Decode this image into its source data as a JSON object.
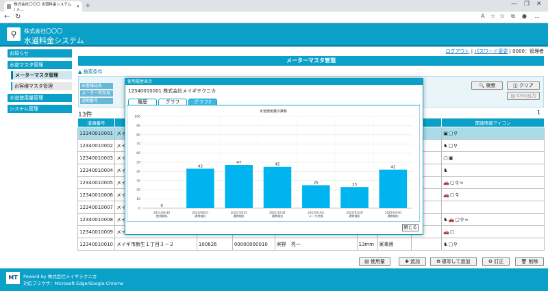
{
  "browser": {
    "tab_title": "株式会社〇〇〇 水道料金システム / メ...",
    "new_tab": "+",
    "url": ""
  },
  "header": {
    "company": "株式会社〇〇〇",
    "system": "水道料金システム"
  },
  "toplinks": {
    "logout": "ログアウト",
    "sep": " | ",
    "change_password": "パスワード変更",
    "user": " | 0000：管理者"
  },
  "sidebar": {
    "items": [
      {
        "label": "お知らせ"
      },
      {
        "label": "水道マスタ管理"
      },
      {
        "label": "メーターマスタ管理"
      },
      {
        "label": "お客様マスタ管理"
      },
      {
        "label": "水道使用量管理"
      },
      {
        "label": "システム管理"
      }
    ]
  },
  "main": {
    "title": "メーターマスタ管理",
    "cond_header": "▲ 検索条件",
    "cond_labels": [
      "お客様氏名",
      "メーター所在地",
      "週期番号"
    ],
    "search_button": "検索",
    "clear_button": "クリア",
    "csv_button": "CSV出力",
    "count": "13件",
    "page": "1"
  },
  "table": {
    "headers": [
      "道順番号",
      "",
      "",
      "",
      "",
      "",
      "",
      "",
      "関連情報アイコン"
    ],
    "rows": [
      {
        "no": "12340010001",
        "c2": "メイ"
      },
      {
        "no": "12340010002",
        "c2": "メイ"
      },
      {
        "no": "12340010003",
        "c2": "メイ"
      },
      {
        "no": "12340010004",
        "c2": "メイ"
      },
      {
        "no": "12340010005",
        "c2": "メイ"
      },
      {
        "no": "12340010006",
        "c2": "メイ"
      },
      {
        "no": "12340010007",
        "c2": "メイ"
      },
      {
        "no": "12340010008",
        "c2": "メイ"
      },
      {
        "no": "12340010009",
        "c2": "メイ"
      },
      {
        "no": "12340010010",
        "c2": "メイギ市新生１丁目３－２",
        "c3": "100626",
        "c4": "00000000010",
        "c5": "呉野　亮一",
        "c6": "13mm",
        "c7": "家事用"
      }
    ]
  },
  "bottom_buttons": {
    "usage": "使用量",
    "add": "追加",
    "copy_add": "複写して追加",
    "edit": "訂正",
    "delete": "削除"
  },
  "footer": {
    "powered": "Powerd by 株式会社メイギテクニカ",
    "browser": "対応ブラウザ：Microsoft Edge/Google Chrome"
  },
  "modal": {
    "title": "使用履歴表示",
    "customer": "12340010001 株式会社メイギテクニカ",
    "tabs": [
      {
        "label": "履歴"
      },
      {
        "label": "グラフ"
      },
      {
        "label": "グラフ2"
      }
    ],
    "close_button": "閉じる"
  },
  "chart_data": {
    "type": "bar",
    "title": "水道使用量の推移",
    "categories": [
      "2021/06/30",
      "2021/08/31",
      "2021/10/31",
      "2021/12/31",
      "2022/01/01",
      "2022/02/28",
      "2022/04/30"
    ],
    "subcategories": [
      "使用開始",
      "通常検針",
      "通常検針",
      "通常検針",
      "メータ交換",
      "通常検針",
      "通常検針"
    ],
    "values": [
      0,
      43,
      47,
      45,
      25,
      23,
      42
    ],
    "ylim": [
      0,
      100
    ],
    "yticks": [
      0,
      10,
      20,
      30,
      40,
      50,
      60,
      70,
      80,
      90,
      100
    ],
    "color": "#00b4f0",
    "grid": true
  }
}
